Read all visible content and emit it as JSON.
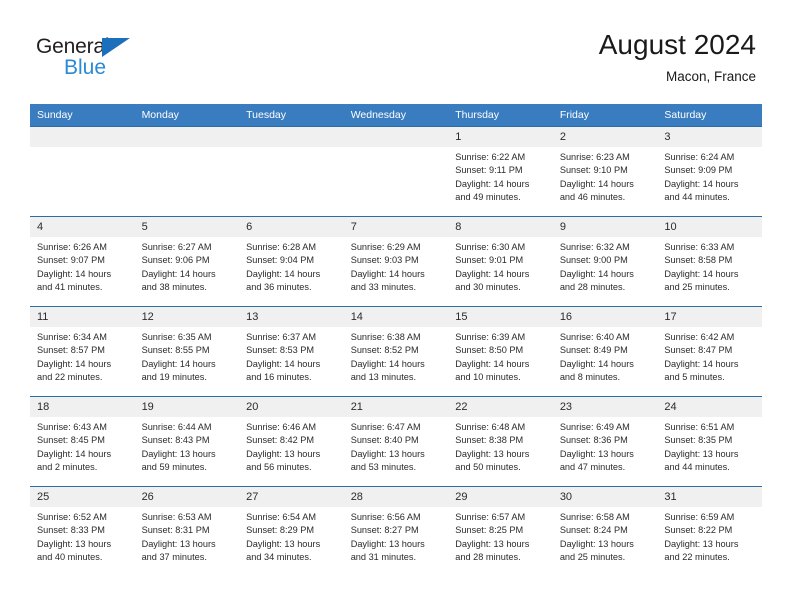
{
  "brand": {
    "name_part1": "General",
    "name_part2": "Blue",
    "accent_color": "#2b8ad6",
    "triangle_color": "#1c6fba"
  },
  "header": {
    "title": "August 2024",
    "subtitle": "Macon, France"
  },
  "calendar": {
    "header_background": "#3a7cc0",
    "daynum_background": "#f0f0f0",
    "weekday_headers": [
      "Sunday",
      "Monday",
      "Tuesday",
      "Wednesday",
      "Thursday",
      "Friday",
      "Saturday"
    ],
    "weeks": [
      [
        {
          "day": "",
          "lines": []
        },
        {
          "day": "",
          "lines": []
        },
        {
          "day": "",
          "lines": []
        },
        {
          "day": "",
          "lines": []
        },
        {
          "day": "1",
          "lines": [
            "Sunrise: 6:22 AM",
            "Sunset: 9:11 PM",
            "Daylight: 14 hours",
            "and 49 minutes."
          ]
        },
        {
          "day": "2",
          "lines": [
            "Sunrise: 6:23 AM",
            "Sunset: 9:10 PM",
            "Daylight: 14 hours",
            "and 46 minutes."
          ]
        },
        {
          "day": "3",
          "lines": [
            "Sunrise: 6:24 AM",
            "Sunset: 9:09 PM",
            "Daylight: 14 hours",
            "and 44 minutes."
          ]
        }
      ],
      [
        {
          "day": "4",
          "lines": [
            "Sunrise: 6:26 AM",
            "Sunset: 9:07 PM",
            "Daylight: 14 hours",
            "and 41 minutes."
          ]
        },
        {
          "day": "5",
          "lines": [
            "Sunrise: 6:27 AM",
            "Sunset: 9:06 PM",
            "Daylight: 14 hours",
            "and 38 minutes."
          ]
        },
        {
          "day": "6",
          "lines": [
            "Sunrise: 6:28 AM",
            "Sunset: 9:04 PM",
            "Daylight: 14 hours",
            "and 36 minutes."
          ]
        },
        {
          "day": "7",
          "lines": [
            "Sunrise: 6:29 AM",
            "Sunset: 9:03 PM",
            "Daylight: 14 hours",
            "and 33 minutes."
          ]
        },
        {
          "day": "8",
          "lines": [
            "Sunrise: 6:30 AM",
            "Sunset: 9:01 PM",
            "Daylight: 14 hours",
            "and 30 minutes."
          ]
        },
        {
          "day": "9",
          "lines": [
            "Sunrise: 6:32 AM",
            "Sunset: 9:00 PM",
            "Daylight: 14 hours",
            "and 28 minutes."
          ]
        },
        {
          "day": "10",
          "lines": [
            "Sunrise: 6:33 AM",
            "Sunset: 8:58 PM",
            "Daylight: 14 hours",
            "and 25 minutes."
          ]
        }
      ],
      [
        {
          "day": "11",
          "lines": [
            "Sunrise: 6:34 AM",
            "Sunset: 8:57 PM",
            "Daylight: 14 hours",
            "and 22 minutes."
          ]
        },
        {
          "day": "12",
          "lines": [
            "Sunrise: 6:35 AM",
            "Sunset: 8:55 PM",
            "Daylight: 14 hours",
            "and 19 minutes."
          ]
        },
        {
          "day": "13",
          "lines": [
            "Sunrise: 6:37 AM",
            "Sunset: 8:53 PM",
            "Daylight: 14 hours",
            "and 16 minutes."
          ]
        },
        {
          "day": "14",
          "lines": [
            "Sunrise: 6:38 AM",
            "Sunset: 8:52 PM",
            "Daylight: 14 hours",
            "and 13 minutes."
          ]
        },
        {
          "day": "15",
          "lines": [
            "Sunrise: 6:39 AM",
            "Sunset: 8:50 PM",
            "Daylight: 14 hours",
            "and 10 minutes."
          ]
        },
        {
          "day": "16",
          "lines": [
            "Sunrise: 6:40 AM",
            "Sunset: 8:49 PM",
            "Daylight: 14 hours",
            "and 8 minutes."
          ]
        },
        {
          "day": "17",
          "lines": [
            "Sunrise: 6:42 AM",
            "Sunset: 8:47 PM",
            "Daylight: 14 hours",
            "and 5 minutes."
          ]
        }
      ],
      [
        {
          "day": "18",
          "lines": [
            "Sunrise: 6:43 AM",
            "Sunset: 8:45 PM",
            "Daylight: 14 hours",
            "and 2 minutes."
          ]
        },
        {
          "day": "19",
          "lines": [
            "Sunrise: 6:44 AM",
            "Sunset: 8:43 PM",
            "Daylight: 13 hours",
            "and 59 minutes."
          ]
        },
        {
          "day": "20",
          "lines": [
            "Sunrise: 6:46 AM",
            "Sunset: 8:42 PM",
            "Daylight: 13 hours",
            "and 56 minutes."
          ]
        },
        {
          "day": "21",
          "lines": [
            "Sunrise: 6:47 AM",
            "Sunset: 8:40 PM",
            "Daylight: 13 hours",
            "and 53 minutes."
          ]
        },
        {
          "day": "22",
          "lines": [
            "Sunrise: 6:48 AM",
            "Sunset: 8:38 PM",
            "Daylight: 13 hours",
            "and 50 minutes."
          ]
        },
        {
          "day": "23",
          "lines": [
            "Sunrise: 6:49 AM",
            "Sunset: 8:36 PM",
            "Daylight: 13 hours",
            "and 47 minutes."
          ]
        },
        {
          "day": "24",
          "lines": [
            "Sunrise: 6:51 AM",
            "Sunset: 8:35 PM",
            "Daylight: 13 hours",
            "and 44 minutes."
          ]
        }
      ],
      [
        {
          "day": "25",
          "lines": [
            "Sunrise: 6:52 AM",
            "Sunset: 8:33 PM",
            "Daylight: 13 hours",
            "and 40 minutes."
          ]
        },
        {
          "day": "26",
          "lines": [
            "Sunrise: 6:53 AM",
            "Sunset: 8:31 PM",
            "Daylight: 13 hours",
            "and 37 minutes."
          ]
        },
        {
          "day": "27",
          "lines": [
            "Sunrise: 6:54 AM",
            "Sunset: 8:29 PM",
            "Daylight: 13 hours",
            "and 34 minutes."
          ]
        },
        {
          "day": "28",
          "lines": [
            "Sunrise: 6:56 AM",
            "Sunset: 8:27 PM",
            "Daylight: 13 hours",
            "and 31 minutes."
          ]
        },
        {
          "day": "29",
          "lines": [
            "Sunrise: 6:57 AM",
            "Sunset: 8:25 PM",
            "Daylight: 13 hours",
            "and 28 minutes."
          ]
        },
        {
          "day": "30",
          "lines": [
            "Sunrise: 6:58 AM",
            "Sunset: 8:24 PM",
            "Daylight: 13 hours",
            "and 25 minutes."
          ]
        },
        {
          "day": "31",
          "lines": [
            "Sunrise: 6:59 AM",
            "Sunset: 8:22 PM",
            "Daylight: 13 hours",
            "and 22 minutes."
          ]
        }
      ]
    ]
  }
}
